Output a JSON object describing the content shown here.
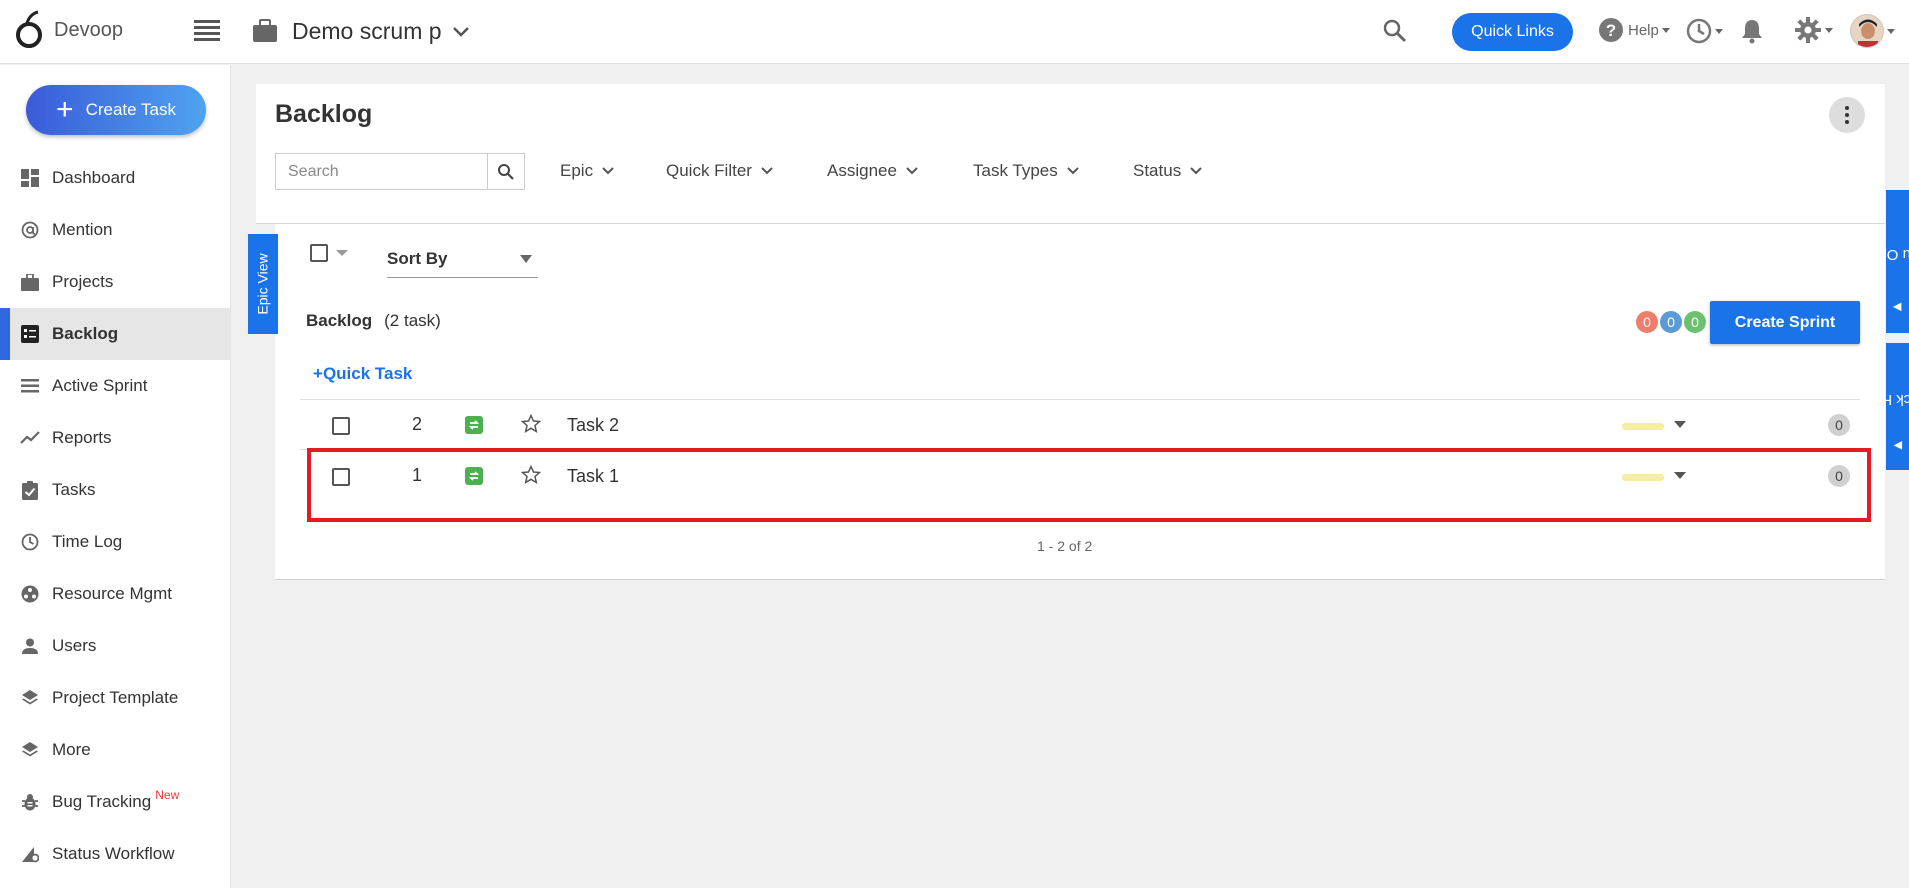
{
  "app": {
    "name": "Devoop"
  },
  "header": {
    "project_name": "Demo scrum p",
    "quick_links_label": "Quick Links",
    "help_label": "Help"
  },
  "sidebar": {
    "create_task_label": "Create Task",
    "items": [
      {
        "label": "Dashboard",
        "icon": "dashboard-icon"
      },
      {
        "label": "Mention",
        "icon": "at-icon"
      },
      {
        "label": "Projects",
        "icon": "briefcase-icon"
      },
      {
        "label": "Backlog",
        "icon": "backlog-icon",
        "active": true
      },
      {
        "label": "Active Sprint",
        "icon": "sprint-icon"
      },
      {
        "label": "Reports",
        "icon": "chart-line-icon"
      },
      {
        "label": "Tasks",
        "icon": "clipboard-check-icon"
      },
      {
        "label": "Time Log",
        "icon": "clock-icon"
      },
      {
        "label": "Resource Mgmt",
        "icon": "resource-icon"
      },
      {
        "label": "Users",
        "icon": "user-icon"
      },
      {
        "label": "Project Template",
        "icon": "layers-icon"
      },
      {
        "label": "More",
        "icon": "layers-icon"
      },
      {
        "label": "Bug Tracking",
        "icon": "bug-icon",
        "badge": "New"
      },
      {
        "label": "Status Workflow",
        "icon": "workflow-icon"
      }
    ]
  },
  "main": {
    "title": "Backlog",
    "search_placeholder": "Search",
    "filters": [
      "Epic",
      "Quick Filter",
      "Assignee",
      "Task Types",
      "Status"
    ],
    "epic_view_label": "Epic View",
    "sort_by_label": "Sort By",
    "backlog_label": "Backlog",
    "backlog_count": "(2 task)",
    "status_dots": [
      {
        "value": "0",
        "color": "#ef7d6e"
      },
      {
        "value": "0",
        "color": "#5b9bd5"
      },
      {
        "value": "0",
        "color": "#6cc070"
      }
    ],
    "create_sprint_label": "Create Sprint",
    "quick_task_label": "Quick Task",
    "tasks": [
      {
        "id": "2",
        "name": "Task 2",
        "count": "0"
      },
      {
        "id": "1",
        "name": "Task 1",
        "count": "0"
      }
    ],
    "pagination": "1 - 2 of 2"
  },
  "right_tabs": {
    "menu_option": "Menu Option",
    "quick_help": "Quick Help"
  }
}
